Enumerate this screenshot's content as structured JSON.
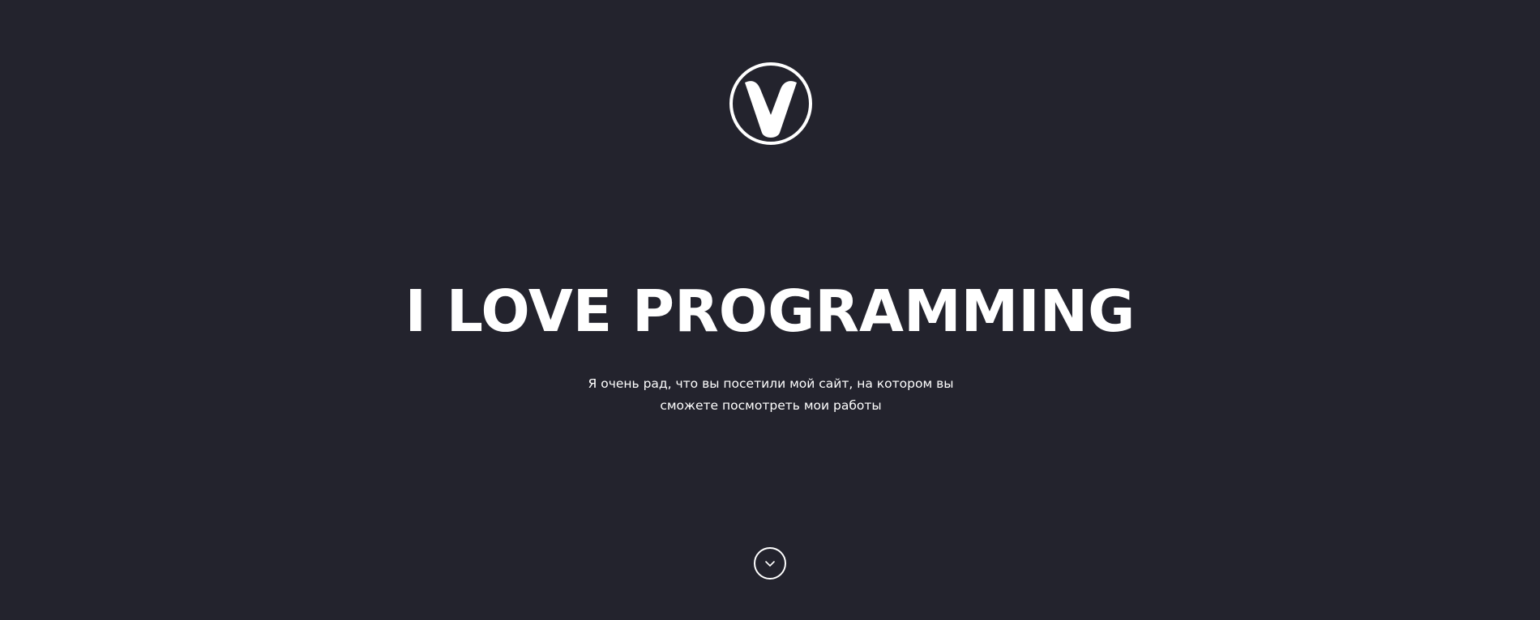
{
  "header": {
    "logo_letter": "V",
    "logo_icon": "v-circle-logo-icon"
  },
  "hero": {
    "title": "I LOVE PROGRAMMING",
    "subtitle": "Я очень рад, что вы посетили мой сайт, на котором вы сможете посмотреть мои работы"
  },
  "scroll": {
    "icon": "chevron-down-icon"
  },
  "colors": {
    "background": "#23232d",
    "text": "#ffffff"
  }
}
